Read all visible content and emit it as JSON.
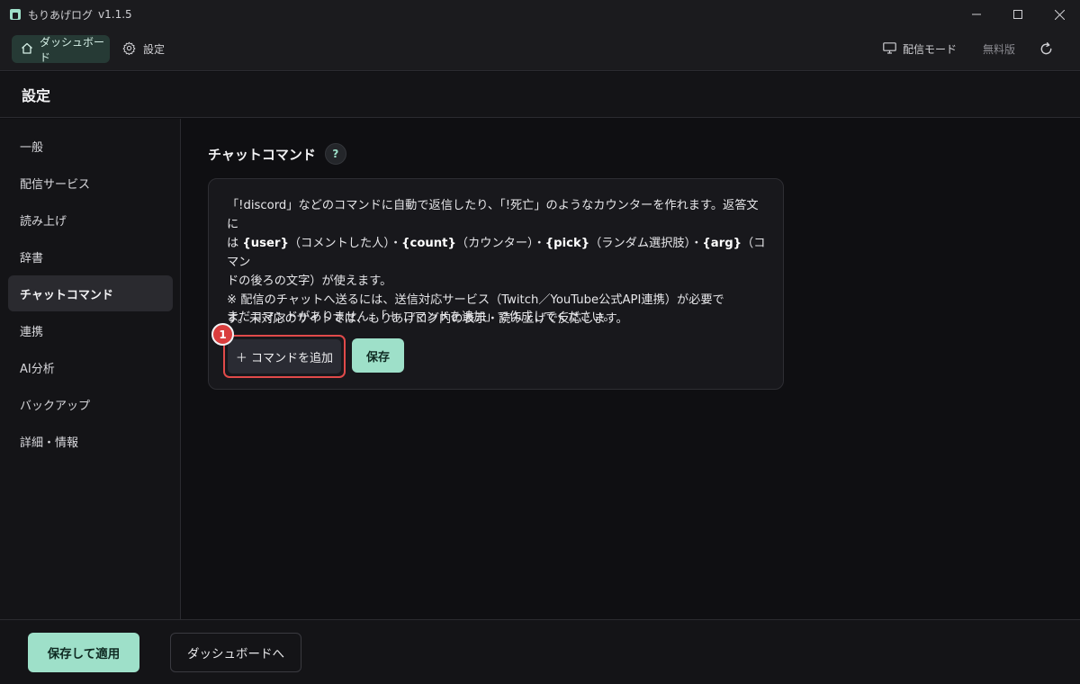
{
  "window": {
    "title": "もりあげログ",
    "version": "v1.1.5",
    "icons": {
      "app": "app-logo-icon",
      "minimize": "minimize-icon",
      "maximize": "maximize-icon",
      "close": "close-icon"
    }
  },
  "topnav": {
    "dashboard_label": "ダッシュボード",
    "settings_label": "設定",
    "stream_mode_label": "配信モード",
    "plan_label": "無料版",
    "icons": {
      "dashboard": "home-icon",
      "settings": "gear-icon",
      "stream_mode": "monitor-icon",
      "refresh": "refresh-icon"
    }
  },
  "page": {
    "title": "設定"
  },
  "sidebar": {
    "items": [
      {
        "label": "一般"
      },
      {
        "label": "配信サービス"
      },
      {
        "label": "読み上げ"
      },
      {
        "label": "辞書"
      },
      {
        "label": "チャットコマンド",
        "active": true
      },
      {
        "label": "連携"
      },
      {
        "label": "AI分析"
      },
      {
        "label": "バックアップ"
      },
      {
        "label": "詳細・情報"
      }
    ]
  },
  "section": {
    "title": "チャットコマンド",
    "help_label": "?",
    "desc": {
      "l1_a": "「!discord」などのコマンドに自動で返信したり、「!死亡」のようなカウンターを作れます。返答文に",
      "l2_a": "は ",
      "var_user": "{user}",
      "l2_b": "（コメントした人）・",
      "var_count": "{count}",
      "l2_c": "（カウンター）・",
      "var_pick": "{pick}",
      "l2_d": "（ランダム選択肢）・",
      "var_arg": "{arg}",
      "l2_e": "（コマン",
      "l3": "ドの後ろの文字）が使えます。",
      "l4": "※ 配信のチャットへ送るには、送信対応サービス（Twitch／YouTube公式API連携）が必要で",
      "l5": "す。未対応のサイトでは、もりあげログ内の表示・読み上げで反応します。"
    },
    "empty_message": "まだコマンドがありません。「＋ コマンドを追加」で作成してください。",
    "add_button": "＋ コマンドを追加",
    "save_button": "保存",
    "badge": "1"
  },
  "footer": {
    "apply_button": "保存して適用",
    "to_dashboard_button": "ダッシュボードへ"
  },
  "colors": {
    "accent": "#9ee0c9",
    "background": "#0f0f12",
    "panel": "#141417",
    "highlight": "#e04a4a"
  }
}
